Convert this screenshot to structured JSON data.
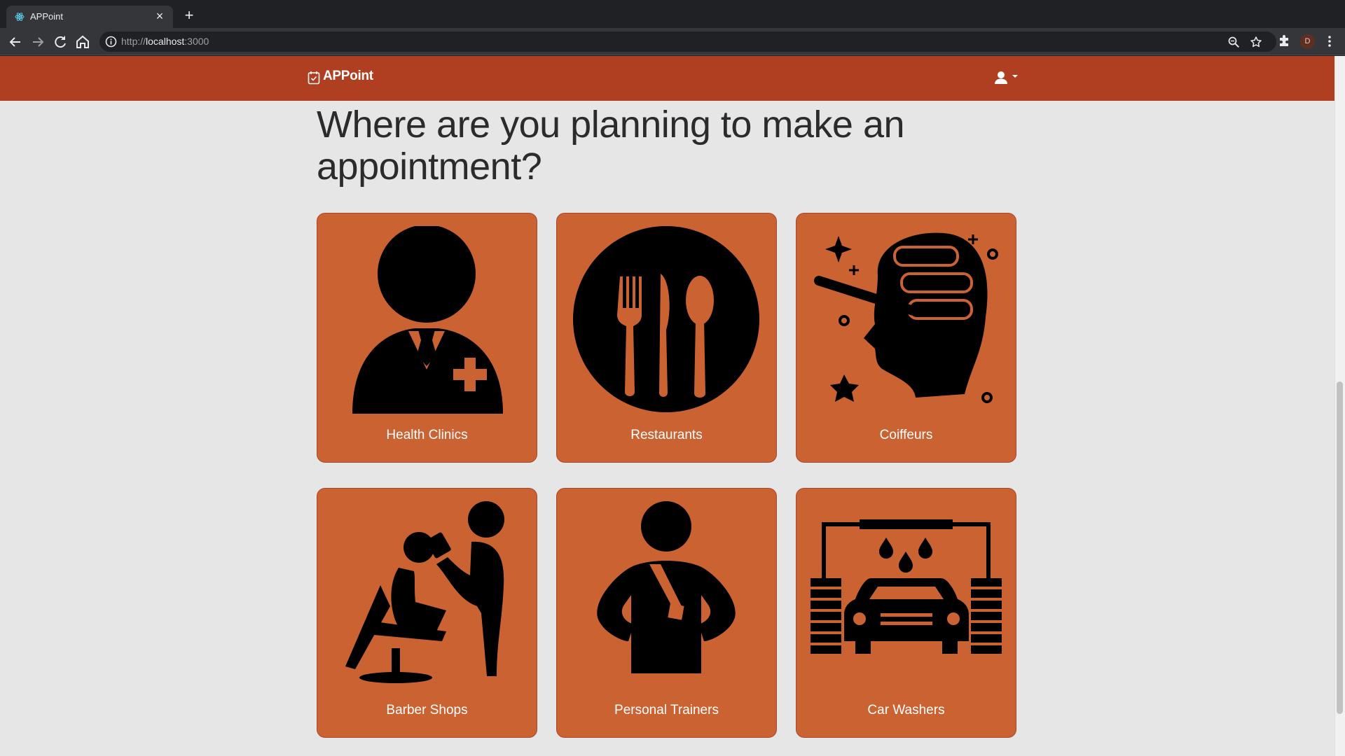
{
  "browser": {
    "tab_title": "APPoint",
    "url_scheme": "http://",
    "url_host": "localhost",
    "url_port": ":3000",
    "profile_initial": "D"
  },
  "navbar": {
    "brand": "APPoint"
  },
  "main": {
    "headline": "Where are you planning to make an appointment?",
    "categories": [
      {
        "label": "Health Clinics",
        "icon": "doctor-icon"
      },
      {
        "label": "Restaurants",
        "icon": "cutlery-icon"
      },
      {
        "label": "Coiffeurs",
        "icon": "hair-rollers-icon"
      },
      {
        "label": "Barber Shops",
        "icon": "barber-icon"
      },
      {
        "label": "Personal Trainers",
        "icon": "trainer-icon"
      },
      {
        "label": "Car Washers",
        "icon": "car-wash-icon"
      }
    ]
  },
  "colors": {
    "navbar": "#b03e21",
    "card": "#cb6232",
    "page_background": "#e6e6e6"
  }
}
